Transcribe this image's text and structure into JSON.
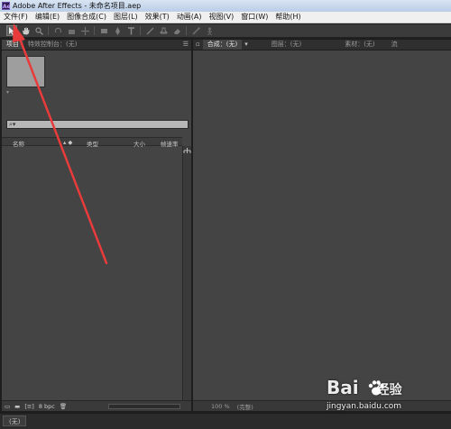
{
  "window": {
    "title": "Adobe After Effects - 未命名项目.aep",
    "app_icon": "Ae"
  },
  "menu": [
    "文件(F)",
    "编辑(E)",
    "图像合成(C)",
    "图层(L)",
    "效果(T)",
    "动画(A)",
    "视图(V)",
    "窗口(W)",
    "帮助(H)"
  ],
  "toolbar": {
    "tools": [
      "selection-tool-icon",
      "hand-tool-icon",
      "zoom-tool-icon",
      "rotate-tool-icon",
      "camera-tool-icon",
      "pan-behind-tool-icon",
      "rectangle-tool-icon",
      "pen-tool-icon",
      "text-tool-icon",
      "brush-tool-icon",
      "clone-stamp-tool-icon",
      "eraser-tool-icon",
      "roto-brush-tool-icon",
      "puppet-tool-icon"
    ],
    "active_tool": "selection-tool-icon"
  },
  "project_panel": {
    "tabs": [
      "项目",
      "特效控制台：(无)"
    ],
    "columns": [
      "名称",
      "类型",
      "大小",
      "帧速率"
    ],
    "search_placeholder": "",
    "footer_bpc": "8 bpc"
  },
  "comp_panel": {
    "tabs": [
      "合成：(无)",
      "图层：(无)",
      "素材：(无)",
      "流"
    ],
    "footer": [
      "100 %",
      "(完整)"
    ]
  },
  "status_bar": {
    "tab": "(无)"
  },
  "watermark": {
    "logo": "Bai",
    "logo_suffix": "经验",
    "url": "jingyan.baidu.com"
  },
  "annotation": {
    "color": "#e83b3b"
  },
  "colors": {
    "panel_bg": "#444444",
    "tab_bar": "#2f2f2f",
    "menu_bg": "#f0f0f0"
  }
}
